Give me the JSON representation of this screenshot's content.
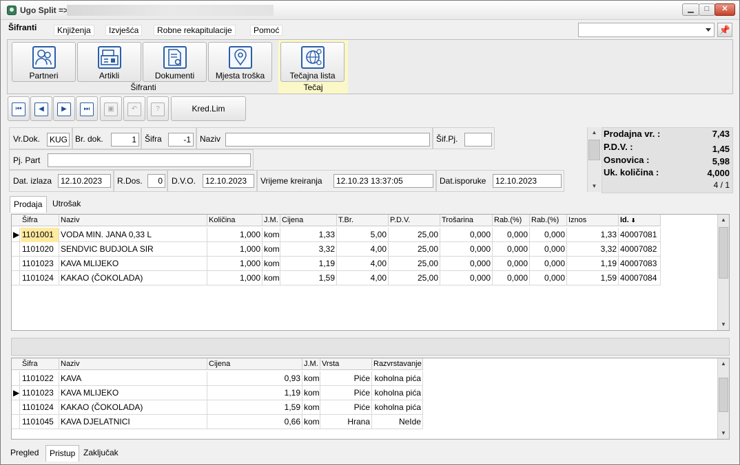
{
  "title": "Ugo Split =>",
  "menu": {
    "active": "Šifranti",
    "tabs": [
      "Knjiženja",
      "Izvješća",
      "Robne rekapitulacije",
      "Pomoć"
    ]
  },
  "ribbon": {
    "group1": {
      "label": "Šifranti",
      "buttons": [
        "Partneri",
        "Artikli",
        "Dokumenti",
        "Mjesta troška"
      ]
    },
    "group2": {
      "label": "Tečaj",
      "buttons": [
        "Tečajna lista"
      ]
    }
  },
  "toolbar": {
    "kred": "Kred.Lim"
  },
  "header": {
    "vrdok_label": "Vr.Dok.",
    "vrdok": "KUG",
    "brdok_label": "Br. dok.",
    "brdok": "1",
    "sifra_label": "Šifra",
    "sifra": "-1",
    "naziv_label": "Naziv",
    "naziv": "",
    "sifpj_label": "Šif.Pj.",
    "sifpj": "",
    "pjpart_label": "Pj. Part",
    "pjpart": "",
    "datizlaza_label": "Dat. izlaza",
    "datizlaza": "12.10.2023",
    "rdos_label": "R.Dos.",
    "rdos": "0",
    "dvo_label": "D.V.O.",
    "dvo": "12.10.2023",
    "vrijeme_label": "Vrijeme kreiranja",
    "vrijeme": "12.10.23 13:37:05",
    "datisp_label": "Dat.isporuke",
    "datisp": "12.10.2023"
  },
  "totals": {
    "prodajna_label": "Prodajna vr. :",
    "prodajna": "7,43",
    "pdv_label": "P.D.V. :",
    "pdv": "1,45",
    "osnovica_label": "Osnovica :",
    "osnovica": "5,98",
    "kolicina_label": "Uk. količina :",
    "kolicina": "4,000",
    "page": "4 / 1"
  },
  "tabs_top": [
    "Prodaja",
    "Utrošak"
  ],
  "grid1": {
    "columns": [
      "Šifra",
      "Naziv",
      "Količina",
      "J.M.",
      "Cijena",
      "T.Br.",
      "P.D.V.",
      "Trošarina",
      "Rab.(%)",
      "Rab.(%)",
      "Iznos",
      "Id."
    ],
    "rows": [
      [
        "1101001",
        "VODA MIN. JANA 0,33 L",
        "1,000",
        "kom",
        "1,33",
        "5,00",
        "25,00",
        "0,000",
        "0,000",
        "0,000",
        "1,33",
        "40007081"
      ],
      [
        "1101020",
        "SENDVIC BUDJOLA SIR",
        "1,000",
        "kom",
        "3,32",
        "4,00",
        "25,00",
        "0,000",
        "0,000",
        "0,000",
        "3,32",
        "40007082"
      ],
      [
        "1101023",
        "KAVA MLIJEKO",
        "1,000",
        "kom",
        "1,19",
        "4,00",
        "25,00",
        "0,000",
        "0,000",
        "0,000",
        "1,19",
        "40007083"
      ],
      [
        "1101024",
        "KAKAO (ČOKOLADA)",
        "1,000",
        "kom",
        "1,59",
        "4,00",
        "25,00",
        "0,000",
        "0,000",
        "0,000",
        "1,59",
        "40007084"
      ]
    ]
  },
  "grid2": {
    "columns": [
      "Šifra",
      "Naziv",
      "Cijena",
      "J.M.",
      "Vrsta",
      "Razvrstavanje"
    ],
    "rows": [
      [
        "1101022",
        "KAVA",
        "0,93",
        "kom",
        "Piće",
        "koholna pića"
      ],
      [
        "1101023",
        "KAVA MLIJEKO",
        "1,19",
        "kom",
        "Piće",
        "koholna pića"
      ],
      [
        "1101024",
        "KAKAO (ČOKOLADA)",
        "1,59",
        "kom",
        "Piće",
        "koholna pića"
      ],
      [
        "1101045",
        "KAVA DJELATNICI",
        "0,66",
        "kom",
        "Hrana",
        "NeIde"
      ]
    ]
  },
  "tabs_bottom": [
    "Pregled",
    "Pristup",
    "Zaključak"
  ]
}
